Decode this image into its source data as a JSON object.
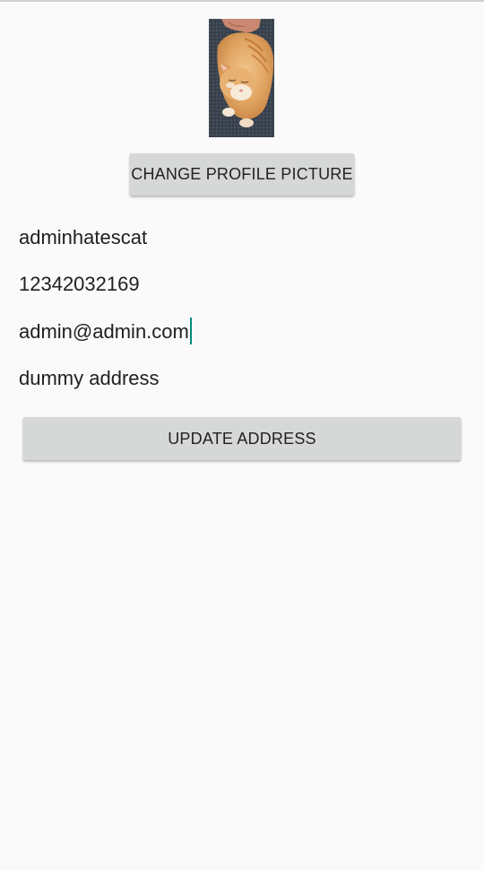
{
  "profile": {
    "picture_alt": "profile picture (orange kitten)",
    "change_picture_label": "CHANGE PROFILE PICTURE"
  },
  "fields": {
    "username": "adminhatescat",
    "phone": "12342032169",
    "email": "admin@admin.com",
    "address": "dummy address"
  },
  "actions": {
    "update_address_label": "UPDATE ADDRESS"
  },
  "colors": {
    "background": "#fafafa",
    "button": "#d6d7d7",
    "cursor_accent": "#00897b"
  }
}
